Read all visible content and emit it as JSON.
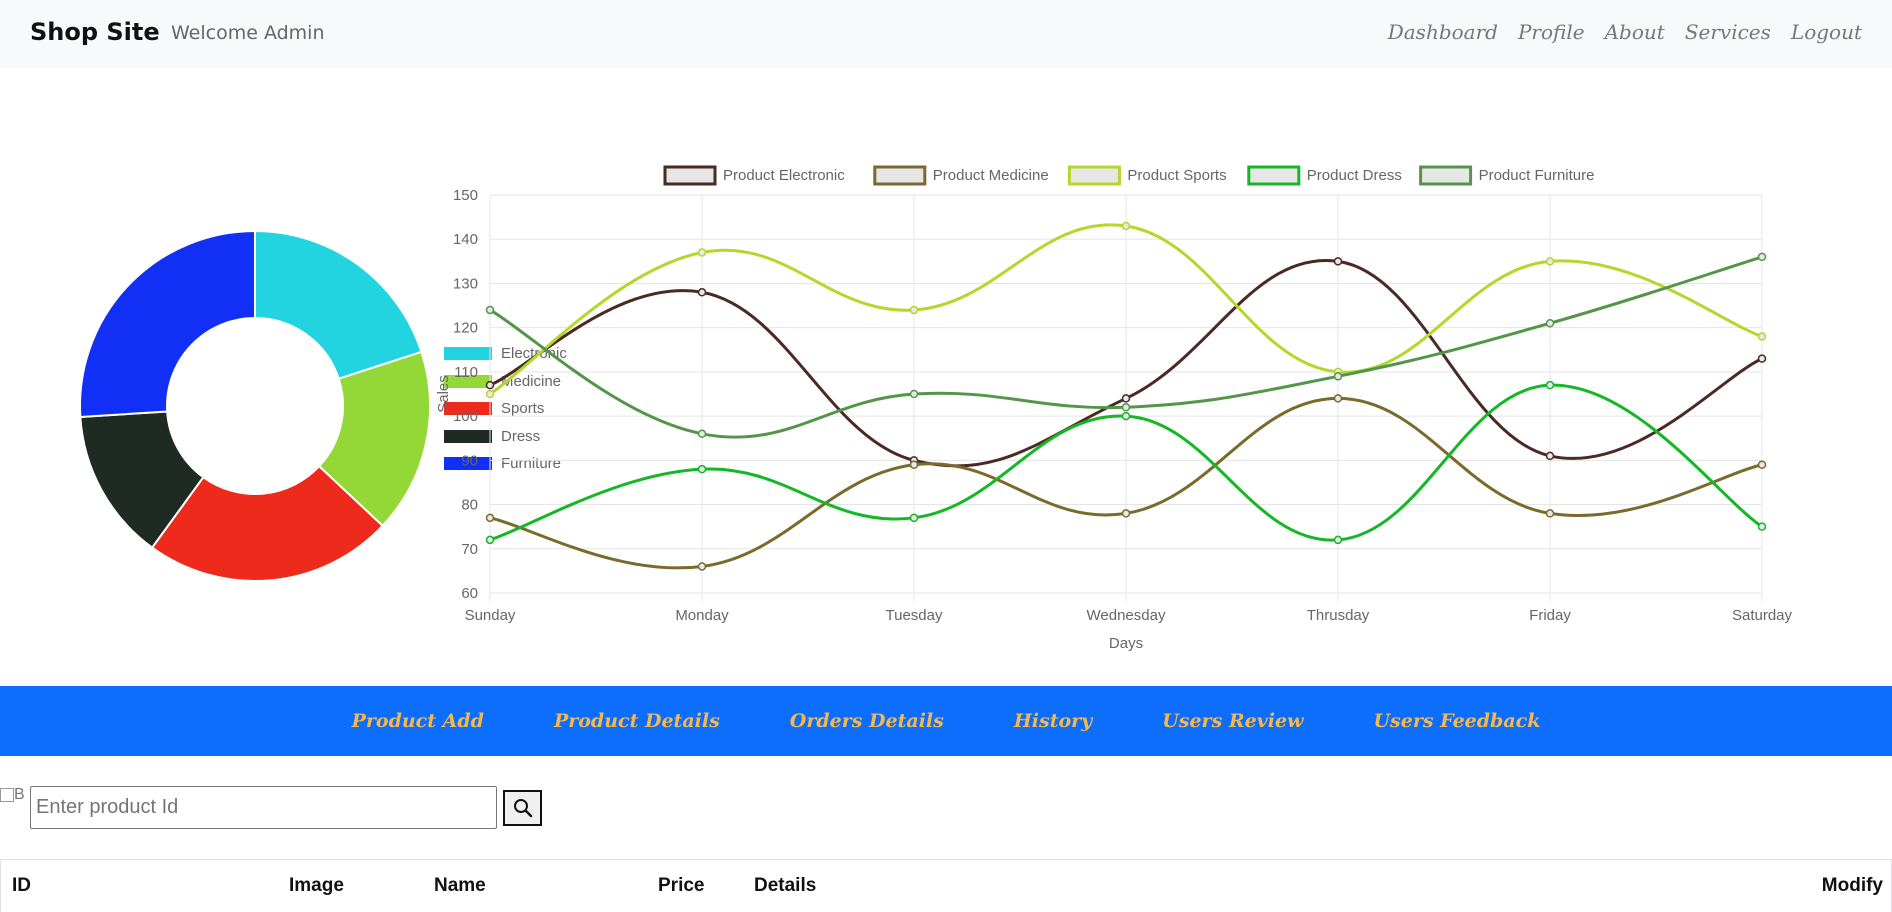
{
  "navbar": {
    "brand": "Shop Site",
    "welcome": "Welcome Admin",
    "links": [
      "Dashboard",
      "Profile",
      "About",
      "Services",
      "Logout"
    ]
  },
  "colors": {
    "navbar_bg": "#f8f9fa",
    "tabbar_bg": "#0d6efd",
    "tab_text": "#f5b84a"
  },
  "chart_data": [
    {
      "type": "pie",
      "variant": "doughnut",
      "categories": [
        "Electronic",
        "Medicine",
        "Sports",
        "Dress",
        "Furniture"
      ],
      "values": [
        20,
        17,
        23,
        14,
        26
      ],
      "colors": [
        "#22d3e0",
        "#94d838",
        "#ee2a1c",
        "#1f2a22",
        "#1230f5"
      ],
      "legend": "right"
    },
    {
      "type": "line",
      "x": [
        "Sunday",
        "Monday",
        "Tuesday",
        "Wednesday",
        "Thrusday",
        "Friday",
        "Saturday"
      ],
      "series": [
        {
          "name": "Product Electronic",
          "values": [
            107,
            128,
            90,
            104,
            135,
            91,
            113
          ],
          "color": "#4a2a22"
        },
        {
          "name": "Product Medicine",
          "values": [
            77,
            66,
            89,
            78,
            104,
            78,
            89
          ],
          "color": "#7a6a2c"
        },
        {
          "name": "Product Sports",
          "values": [
            105,
            137,
            124,
            143,
            110,
            135,
            118
          ],
          "color": "#b3d82c"
        },
        {
          "name": "Product Dress",
          "values": [
            72,
            88,
            77,
            100,
            72,
            107,
            75
          ],
          "color": "#14b826"
        },
        {
          "name": "Product Furniture",
          "values": [
            124,
            96,
            105,
            102,
            109,
            121,
            136
          ],
          "color": "#55954a"
        }
      ],
      "xlabel": "Days",
      "ylabel": "Sales",
      "ylim": [
        60,
        150
      ],
      "yticks": [
        60,
        70,
        80,
        90,
        100,
        110,
        120,
        130,
        140,
        150
      ],
      "grid": true,
      "legend": "top"
    }
  ],
  "tabs": [
    "Product Add",
    "Product Details",
    "Orders Details",
    "History",
    "Users Review",
    "Users Feedback"
  ],
  "search": {
    "placeholder": "Enter product Id",
    "broken_image_alt": "B"
  },
  "table": {
    "headers": [
      "ID",
      "Image",
      "Name",
      "Price",
      "Details",
      "Modify"
    ]
  }
}
